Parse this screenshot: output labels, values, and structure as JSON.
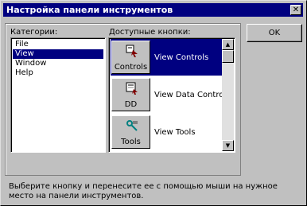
{
  "window": {
    "title": "Настройка панели инструментов",
    "close_label": "✕"
  },
  "categories": {
    "label": "Категории:",
    "items": [
      "File",
      "View",
      "Window",
      "Help"
    ],
    "selected": 1
  },
  "buttons": {
    "label": "Доступные кнопки:",
    "items": [
      {
        "caption": "Controls",
        "description": "View Controls",
        "icon": "controls-icon",
        "selected": true
      },
      {
        "caption": "DD",
        "description": "View Data Controls",
        "icon": "data-controls-icon",
        "selected": false
      },
      {
        "caption": "Tools",
        "description": "View Tools",
        "icon": "tools-icon",
        "selected": false
      }
    ]
  },
  "ok_label": "OK",
  "hint": "Выберите кнопку и перенесите ее с помощью мыши на нужное место на панели инструментов.",
  "colors": {
    "selection": "#000080",
    "title_bar": "#000080",
    "face": "#c0c0c0"
  }
}
